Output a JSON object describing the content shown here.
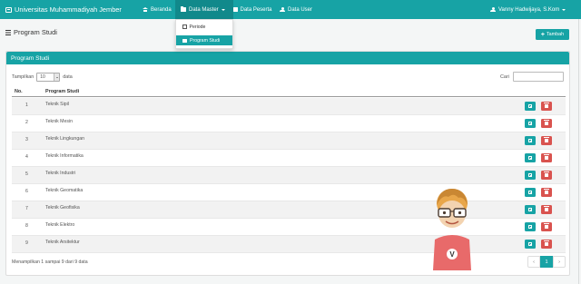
{
  "navbar": {
    "brand": "Universitas Muhammadiyah Jember",
    "items": [
      {
        "label": "Beranda",
        "icon": "home-icon"
      },
      {
        "label": "Data Master",
        "icon": "folder-open-icon"
      },
      {
        "label": "Data Peserta",
        "icon": "file-icon"
      },
      {
        "label": "Data User",
        "icon": "user-icon"
      }
    ],
    "user": "Vanny Hadwijaya, S.Kom",
    "color": "#17a3a5"
  },
  "dropdown": {
    "items": [
      {
        "label": "Periode",
        "icon": "calendar-icon",
        "active": false
      },
      {
        "label": "Program Studi",
        "icon": "id-card-icon",
        "active": true
      }
    ]
  },
  "page": {
    "title": "Program Studi",
    "add_button": "Tambah"
  },
  "card": {
    "header": "Program Studi",
    "show_prefix": "Tampilkan",
    "show_value": "10",
    "show_suffix": "data",
    "search_label": "Cari",
    "columns": [
      "No.",
      "Program Studi"
    ],
    "rows": [
      {
        "no": "1",
        "name": "Teknik Sipil"
      },
      {
        "no": "2",
        "name": "Teknik Mesin"
      },
      {
        "no": "3",
        "name": "Teknik Lingkungan"
      },
      {
        "no": "4",
        "name": "Teknik Informatika"
      },
      {
        "no": "5",
        "name": "Teknik Industri"
      },
      {
        "no": "6",
        "name": "Teknik Geomatika"
      },
      {
        "no": "7",
        "name": "Teknik Geofisika"
      },
      {
        "no": "8",
        "name": "Teknik Elektro"
      },
      {
        "no": "9",
        "name": "Teknik Arsitektur"
      }
    ],
    "info": "Menampilkan 1 sampai 9 dari 9 data",
    "pagination": {
      "prev": "‹",
      "current": "1",
      "next": "›"
    }
  },
  "colors": {
    "accent": "#17a3a5",
    "danger": "#d9534f"
  }
}
